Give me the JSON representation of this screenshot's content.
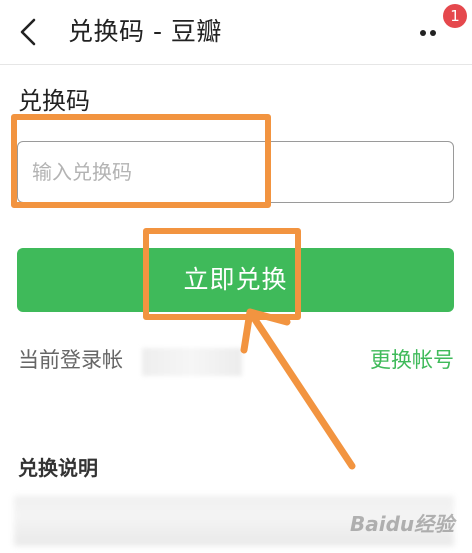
{
  "header": {
    "back_icon": "chevron-left-icon",
    "title": "兑换码 - 豆瓣",
    "more_icon": "more-dots-icon",
    "notification_count": "1"
  },
  "form": {
    "label": "兑换码",
    "placeholder": "输入兑换码",
    "value": "",
    "submit_label": "立即兑换"
  },
  "account": {
    "current_label": "当前登录帐",
    "switch_label": "更换帐号"
  },
  "instructions": {
    "heading": "兑换说明"
  },
  "watermark": "Baidu经验",
  "colors": {
    "accent_green": "#3fba5a",
    "badge_red": "#e5484d",
    "annotation_orange": "#f29440"
  }
}
